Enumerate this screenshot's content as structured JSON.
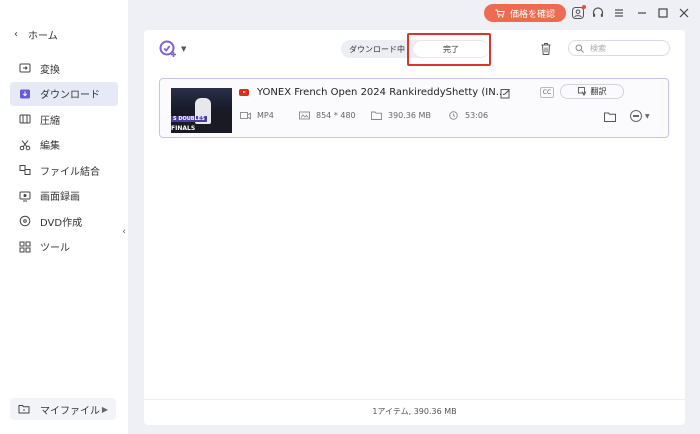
{
  "sidebar": {
    "home_label": "ホーム",
    "items": [
      {
        "label": "変換",
        "icon": "convert-icon"
      },
      {
        "label": "ダウンロード",
        "icon": "download-icon",
        "active": true
      },
      {
        "label": "圧縮",
        "icon": "compress-icon"
      },
      {
        "label": "編集",
        "icon": "scissors-icon"
      },
      {
        "label": "ファイル結合",
        "icon": "merge-icon"
      },
      {
        "label": "画面録画",
        "icon": "screen-record-icon"
      },
      {
        "label": "DVD作成",
        "icon": "disc-icon"
      },
      {
        "label": "ツール",
        "icon": "grid-icon"
      }
    ],
    "my_files_label": "マイファイル"
  },
  "titlebar": {
    "price_button_label": "価格を確認",
    "accent_color": "#ef6a52"
  },
  "toolbar": {
    "tab_downloading": "ダウンロード中",
    "tab_completed": "完了",
    "search_placeholder": "検索"
  },
  "item": {
    "title": "YONEX French Open 2024  RankireddyShetty (IN...",
    "format": "MP4",
    "resolution": "854 * 480",
    "size": "390.36 MB",
    "duration": "53:06",
    "cc_label": "CC",
    "translate_label": "翻訳",
    "thumb_caption_1": "S DOUBLES",
    "thumb_caption_2": "FINALS"
  },
  "footer": {
    "summary": "1アイテム, 390.36 MB"
  }
}
